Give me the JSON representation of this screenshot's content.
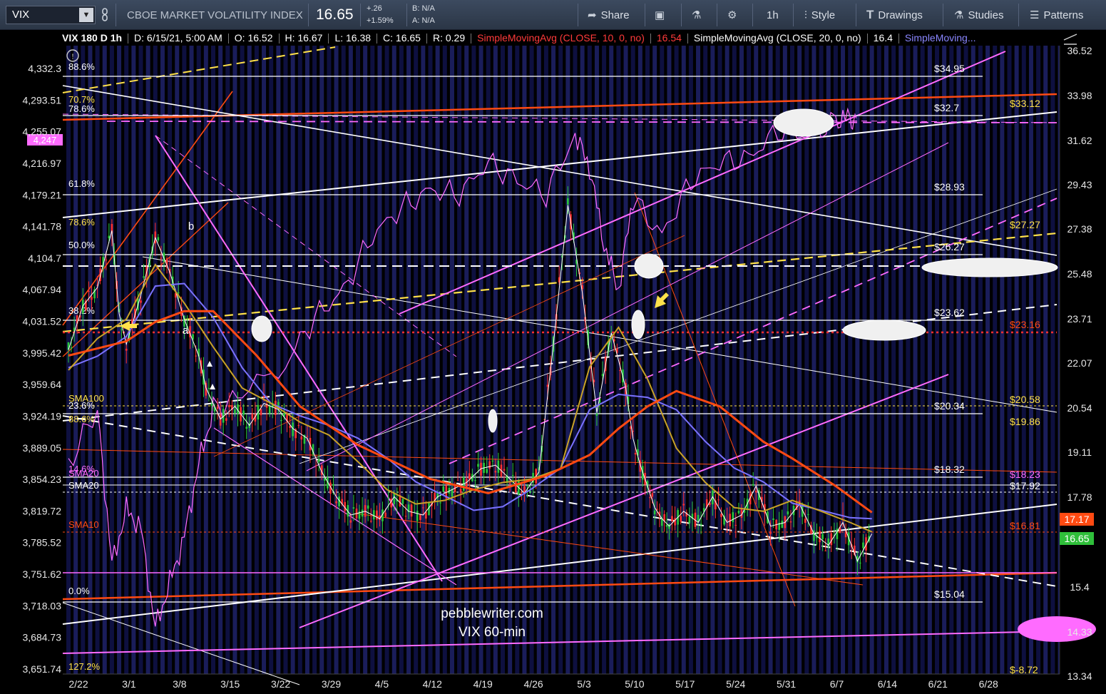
{
  "toolbar": {
    "symbol": "VIX",
    "name": "CBOE MARKET VOLATILITY INDEX",
    "last": "16.65",
    "change": "+.26",
    "change_pct": "+1.59%",
    "bid": "B: N/A",
    "ask": "A: N/A",
    "share": "Share",
    "timeframe": "1h",
    "style": "Style",
    "drawings": "Drawings",
    "studies": "Studies",
    "patterns": "Patterns"
  },
  "status": {
    "title": "VIX 180 D 1h",
    "date": "D: 6/15/21, 5:00 AM",
    "open": "O: 16.52",
    "high": "H: 16.67",
    "low": "L: 16.38",
    "close": "C: 16.65",
    "range": "R: 0.29",
    "sma10_label": "SimpleMovingAvg (CLOSE, 10, 0, no)",
    "sma10_val": "16.54",
    "sma20_label": "SimpleMovingAvg (CLOSE, 20, 0, no)",
    "sma20_val": "16.4",
    "sma_more": "SimpleMoving..."
  },
  "colors": {
    "background": "#000000",
    "band_a": "#0e1040",
    "band_b": "#1a1d5a",
    "orange": "#ff4a12",
    "magenta": "#ff6bff",
    "yellow": "#ffe14a",
    "blue": "#7b72ff",
    "green": "#28c83c",
    "red": "#ff3030"
  },
  "chart_data": {
    "type": "line",
    "title": "VIX 180 D 1h",
    "annotation": [
      "pebblewriter.com",
      "VIX 60-min"
    ],
    "x_ticks": [
      "2/22",
      "3/1",
      "3/8",
      "3/15",
      "3/22",
      "3/29",
      "4/5",
      "4/12",
      "4/19",
      "4/26",
      "5/3",
      "5/10",
      "5/17",
      "5/24",
      "5/31",
      "6/7",
      "6/14",
      "6/21",
      "6/28"
    ],
    "left_axis_ticks": [
      "4,332.3",
      "4,293.51",
      "4,255.07",
      "4,216.97",
      "4,179.21",
      "4,141.78",
      "4,104.7",
      "4,067.94",
      "4,031.52",
      "3,995.42",
      "3,959.64",
      "3,924.19",
      "3,889.05",
      "3,854.23",
      "3,819.72",
      "3,785.52",
      "3,751.62",
      "3,718.03",
      "3,684.73",
      "3,651.74"
    ],
    "right_axis_ticks": [
      "36.52",
      "33.98",
      "31.62",
      "29.43",
      "27.38",
      "25.48",
      "23.71",
      "22.07",
      "20.54",
      "19.11",
      "17.78",
      "15.4",
      "14.33",
      "13.34"
    ],
    "right_axis_scale": "log",
    "ylim_right": [
      13.3,
      36.8
    ],
    "ylim_left": [
      3640,
      4345
    ],
    "fib_left_labels": [
      "88.6%",
      "70.7%",
      "78.6%",
      "61.8%",
      "78.6%",
      "50.0%",
      "38.2%",
      "23.6%",
      "88.6%",
      "14.6%",
      "0.0%",
      "127.2%"
    ],
    "level_labels": [
      "$34.95",
      "$32.7",
      "$28.93",
      "$26.27",
      "$23.62",
      "$20.34",
      "$18.32",
      "$15.04"
    ],
    "right_level_labels": [
      "$33.12",
      "$27.27",
      "$23.16",
      "$20.58",
      "$19.86",
      "$18.23",
      "$17.92",
      "$16.81",
      "$-8.72"
    ],
    "sma_tags": [
      "SMA100",
      "SMA20",
      "SMA10",
      "SMA20"
    ],
    "price_tags": {
      "spx": "4,247",
      "sma10": "17.17",
      "last": "16.65"
    },
    "letters": [
      "b",
      "a"
    ],
    "series": [
      {
        "name": "VIX",
        "x_days": [
          0,
          2,
          4,
          6,
          7,
          8,
          10,
          12,
          14,
          16,
          18,
          19,
          21,
          23,
          25,
          27,
          29,
          31,
          33,
          35,
          37,
          39,
          41,
          43,
          45,
          47,
          49,
          51,
          53,
          55,
          57,
          59,
          61,
          63,
          65,
          67,
          69,
          71,
          73,
          75,
          77,
          78,
          79,
          80,
          81,
          82,
          83,
          85,
          87,
          89,
          91,
          93,
          95,
          97,
          99,
          101,
          103,
          105,
          107,
          109,
          111
        ],
        "values": [
          22.2,
          23.8,
          24.5,
          26.8,
          23.5,
          22.4,
          24.2,
          26.5,
          25.1,
          23.3,
          22.0,
          20.9,
          19.9,
          20.3,
          19.7,
          20.4,
          20.2,
          19.6,
          19.3,
          18.3,
          17.6,
          17.1,
          17.2,
          17.0,
          17.6,
          17.2,
          17.1,
          17.6,
          17.8,
          18.0,
          18.4,
          18.5,
          18.1,
          17.7,
          18.3,
          22.4,
          27.9,
          24.3,
          20.1,
          22.8,
          20.9,
          19.3,
          18.5,
          17.9,
          17.3,
          17.0,
          16.8,
          17.2,
          16.9,
          17.6,
          16.9,
          17.1,
          17.9,
          16.8,
          16.9,
          17.4,
          16.6,
          16.3,
          16.9,
          15.9,
          16.6
        ]
      },
      {
        "name": "SMA10",
        "x_days": [
          0,
          4,
          8,
          12,
          16,
          20,
          24,
          28,
          32,
          36,
          40,
          44,
          48,
          52,
          56,
          60,
          64,
          68,
          72,
          76,
          80,
          84,
          88,
          92,
          96,
          100,
          104,
          108,
          111
        ],
        "values": [
          21.8,
          22.2,
          22.9,
          24.8,
          24.9,
          23.6,
          21.8,
          20.6,
          20.2,
          19.9,
          19.5,
          18.9,
          18.2,
          17.8,
          17.4,
          17.5,
          18.0,
          18.6,
          20.4,
          20.9,
          20.8,
          20.4,
          19.4,
          18.6,
          18.2,
          17.6,
          17.4,
          17.2,
          17.17
        ]
      },
      {
        "name": "SMA20",
        "x_days": [
          0,
          4,
          8,
          12,
          16,
          20,
          24,
          28,
          32,
          36,
          40,
          44,
          48,
          52,
          56,
          60,
          64,
          68,
          72,
          76,
          80,
          84,
          88,
          92,
          96,
          100,
          104,
          108,
          111
        ],
        "values": [
          21.5,
          22.6,
          23.3,
          25.4,
          23.9,
          22.3,
          20.9,
          20.4,
          19.8,
          19.4,
          18.6,
          17.8,
          17.4,
          17.5,
          17.8,
          18.0,
          18.1,
          18.4,
          21.6,
          23.0,
          21.2,
          19.0,
          18.0,
          17.3,
          17.2,
          17.5,
          17.2,
          16.9,
          16.65
        ]
      }
    ]
  }
}
